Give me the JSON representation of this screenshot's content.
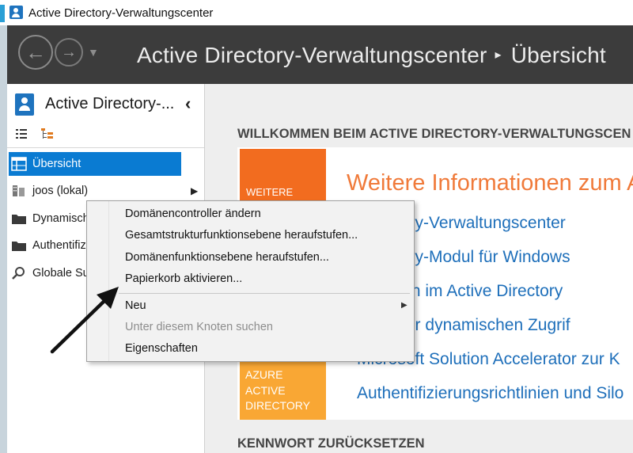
{
  "window": {
    "title": "Active Directory-Verwaltungscenter"
  },
  "header": {
    "breadcrumb_root": "Active Directory-Verwaltungscenter",
    "breadcrumb_separator": "▸",
    "breadcrumb_current": "Übersicht"
  },
  "nav": {
    "title": "Active Directory-...",
    "items": [
      {
        "label": "Übersicht",
        "icon": "overview-icon",
        "selected": true
      },
      {
        "label": "joos (lokal)",
        "icon": "domain-icon",
        "expandable": true
      },
      {
        "label": "Dynamisch",
        "icon": "folder-icon"
      },
      {
        "label": "Authentifiz",
        "icon": "folder-icon"
      },
      {
        "label": "Globale Su",
        "icon": "search-icon"
      }
    ]
  },
  "content": {
    "welcome_heading": "WILLKOMMEN BEIM ACTIVE DIRECTORY-VERWALTUNGSCEN",
    "orange_tile_label": "WEITERE",
    "azure_tile_lines": [
      "AZURE",
      "ACTIVE",
      "DIRECTORY"
    ],
    "info_heading": "Weitere Informationen zum A",
    "links": [
      "Directory-Verwaltungscenter",
      "Directory-Modul für Windows",
      "ntworten im Active Directory",
      "ellen der dynamischen Zugrif",
      "Microsoft Solution Accelerator zur K",
      "Authentifizierungsrichtlinien und Silo"
    ],
    "reset_heading": "KENNWORT ZURÜCKSETZEN"
  },
  "context_menu": {
    "items": [
      {
        "label": "Domänencontroller ändern",
        "enabled": true
      },
      {
        "label": "Gesamtstrukturfunktionsebene heraufstufen...",
        "enabled": true
      },
      {
        "label": "Domänenfunktionsebene heraufstufen...",
        "enabled": true
      },
      {
        "label": "Papierkorb aktivieren...",
        "enabled": true,
        "highlighted_by_arrow": true
      },
      {
        "label": "Neu",
        "enabled": true,
        "has_submenu": true
      },
      {
        "label": "Unter diesem Knoten suchen",
        "enabled": false
      },
      {
        "label": "Eigenschaften",
        "enabled": true
      }
    ]
  },
  "colors": {
    "header_bg": "#3c3c3c",
    "selection": "#0a7bd2",
    "orange_tile": "#f26c1f",
    "azure_tile": "#f9a734",
    "link": "#1e6fba",
    "info_heading": "#f07a3a",
    "annotation_arrow": "#111111"
  }
}
